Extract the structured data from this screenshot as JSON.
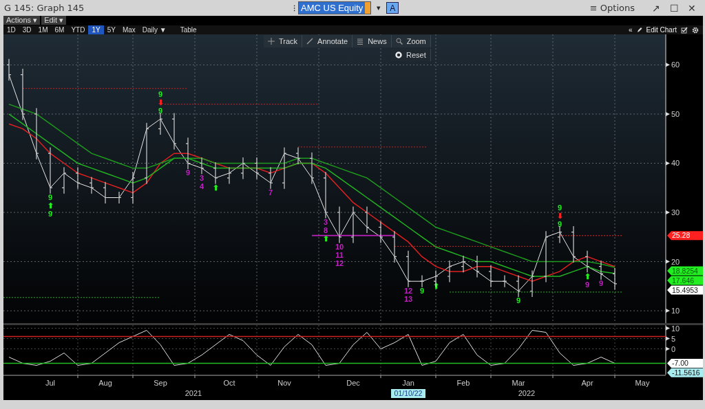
{
  "window": {
    "title": "G 145: Graph 145",
    "security": "AMC US Equity",
    "menu_glyph": "⁝",
    "dropdown_glyph": "▾",
    "mode_button": "A",
    "options": "≡ Options",
    "controls": [
      "↗",
      "☐",
      "✕"
    ]
  },
  "menus": [
    {
      "label": "Actions ▾"
    },
    {
      "label": "Edit ▾"
    }
  ],
  "ranges": [
    {
      "label": "1D",
      "selected": false
    },
    {
      "label": "3D",
      "selected": false
    },
    {
      "label": "1M",
      "selected": false
    },
    {
      "label": "6M",
      "selected": false
    },
    {
      "label": "YTD",
      "selected": false
    },
    {
      "label": "1Y",
      "selected": true
    },
    {
      "label": "5Y",
      "selected": false
    },
    {
      "label": "Max",
      "selected": false
    }
  ],
  "frequency": "Daily ▼",
  "table_button": "Table",
  "collapse_glyph": "«",
  "edit_chart": "Edit Chart",
  "chart_tools": [
    {
      "label": "Track",
      "kind": "crosshair"
    },
    {
      "label": "Annotate",
      "kind": "pencil"
    },
    {
      "label": "News",
      "kind": "list"
    },
    {
      "label": "Zoom",
      "kind": "magnifier"
    }
  ],
  "reset_button": "Reset",
  "price_chart": {
    "chart_data": {
      "type": "line",
      "grid": true,
      "ylim": [
        7.5,
        66.2
      ],
      "yticks": [
        10,
        20,
        30,
        40,
        50,
        60
      ],
      "series": [
        {
          "color": "#e8e8e8",
          "values": [
            58,
            50,
            42,
            35,
            38,
            36,
            35,
            33,
            33,
            37,
            47,
            49,
            44,
            40,
            39,
            37,
            38,
            40,
            38,
            36,
            42,
            41,
            37,
            30,
            25,
            30,
            27,
            25,
            21,
            16,
            16,
            17,
            19,
            20,
            18,
            16,
            16,
            14,
            17,
            25,
            26,
            21,
            19,
            17.5,
            15.5
          ]
        },
        {
          "color": "#e02020",
          "values": [
            48,
            47,
            45,
            42,
            40,
            38,
            37,
            36,
            35,
            34,
            36,
            40,
            42,
            42,
            41,
            40,
            39,
            39,
            39,
            38,
            39,
            40,
            40,
            38,
            35,
            32,
            30,
            28,
            26,
            24,
            21,
            19,
            18,
            18,
            19,
            19,
            18,
            17,
            16,
            17,
            18,
            20,
            21,
            20,
            19
          ]
        },
        {
          "color": "#22b422",
          "values": [
            50,
            48,
            46,
            44,
            42,
            40,
            39,
            38,
            37,
            36,
            37,
            39,
            41,
            41,
            40,
            39,
            39,
            39,
            39,
            39,
            39,
            40,
            40,
            39,
            37,
            35,
            33,
            31,
            29,
            27,
            25,
            23,
            22,
            21,
            20,
            20,
            19,
            18,
            17,
            17,
            17,
            18,
            19,
            18,
            17.6
          ]
        },
        {
          "color": "#1e9a1e",
          "values": [
            52,
            51,
            50,
            48,
            46,
            44,
            42,
            41,
            40,
            39,
            39,
            40,
            41,
            41,
            41,
            40,
            40,
            40,
            40,
            40,
            40,
            41,
            41,
            40,
            39,
            38,
            37,
            35,
            33,
            31,
            29,
            27,
            26,
            25,
            24,
            23,
            22,
            21,
            20,
            20,
            20,
            20,
            20,
            19.5,
            18.8
          ]
        }
      ]
    },
    "count_marks": [
      {
        "text": "9",
        "color": "#22ee22"
      },
      {
        "text": "⬆",
        "color": "#22ee22"
      },
      {
        "text": "9",
        "color": "#22ee22"
      },
      {
        "text": "9",
        "color": "#22ee22"
      },
      {
        "text": "⬇",
        "color": "#ff2020"
      },
      {
        "text": "9",
        "color": "#22ee22"
      },
      {
        "text": "9",
        "color": "#c020c0"
      },
      {
        "text": "3",
        "color": "#c020c0"
      },
      {
        "text": "4",
        "color": "#c020c0"
      },
      {
        "text": "⬆",
        "color": "#22ee22"
      },
      {
        "text": "7",
        "color": "#c020c0"
      },
      {
        "text": "3",
        "color": "#c020c0"
      },
      {
        "text": "8",
        "color": "#c020c0"
      },
      {
        "text": "⬆",
        "color": "#22ee22"
      },
      {
        "text": "10",
        "color": "#c020c0"
      },
      {
        "text": "11",
        "color": "#c020c0"
      },
      {
        "text": "12",
        "color": "#c020c0"
      },
      {
        "text": "12",
        "color": "#c020c0"
      },
      {
        "text": "13",
        "color": "#c020c0"
      },
      {
        "text": "9",
        "color": "#22ee22"
      },
      {
        "text": "⬆",
        "color": "#22ee22"
      },
      {
        "text": "9",
        "color": "#22ee22"
      },
      {
        "text": "9",
        "color": "#22ee22"
      },
      {
        "text": "⬇",
        "color": "#ff2020"
      },
      {
        "text": "9",
        "color": "#22ee22"
      },
      {
        "text": "⬆",
        "color": "#22ee22"
      },
      {
        "text": "9",
        "color": "#c020c0"
      },
      {
        "text": "9",
        "color": "#c020c0"
      }
    ],
    "axis_tags": [
      {
        "text": "25.28",
        "color": "#ff2020"
      },
      {
        "text": "18.8254",
        "color": "#22ee22"
      },
      {
        "text": "17.646",
        "color": "#22ee22"
      },
      {
        "text": "15.4953",
        "color": "#ffffff"
      }
    ]
  },
  "oscillator": {
    "chart_data": {
      "type": "line",
      "grid": true,
      "ylim": [
        -12.5,
        11.5
      ],
      "yticks": [
        10,
        5,
        0
      ],
      "categories": [
        null,
        null,
        null,
        "Jul",
        null,
        null,
        null,
        "Aug",
        null,
        null,
        null,
        "Sep",
        null,
        null,
        null,
        null,
        "Oct",
        null,
        null,
        null,
        "Nov",
        null,
        null,
        null,
        null,
        "Dec",
        null,
        null,
        null,
        "Jan",
        null,
        null,
        null,
        "Feb",
        null,
        null,
        null,
        "Mar",
        null,
        null,
        null,
        null,
        "Apr",
        null,
        null,
        null,
        "May"
      ],
      "series": [
        {
          "color": "#e0e0e0",
          "values": [
            -4,
            -7,
            -8,
            -6,
            -2,
            -8,
            -7,
            -2,
            3,
            6,
            9,
            2,
            -8,
            -7,
            -3,
            2,
            7,
            4,
            -3,
            -8,
            1,
            7,
            2,
            -8,
            -7,
            2,
            8,
            0,
            3,
            7,
            -8,
            -6,
            3,
            7,
            -3,
            -8,
            -7,
            0,
            9,
            8,
            -2,
            -8,
            -7,
            -4,
            -7,
            null,
            null
          ]
        }
      ]
    },
    "axis_tags": [
      {
        "text": "-7.00",
        "color": "#ffffff"
      },
      {
        "text": "-11.5616",
        "color": "#a8ecf0"
      }
    ]
  },
  "year_labels": [
    "2021",
    "2022"
  ],
  "cursor_date": "01/10/22"
}
